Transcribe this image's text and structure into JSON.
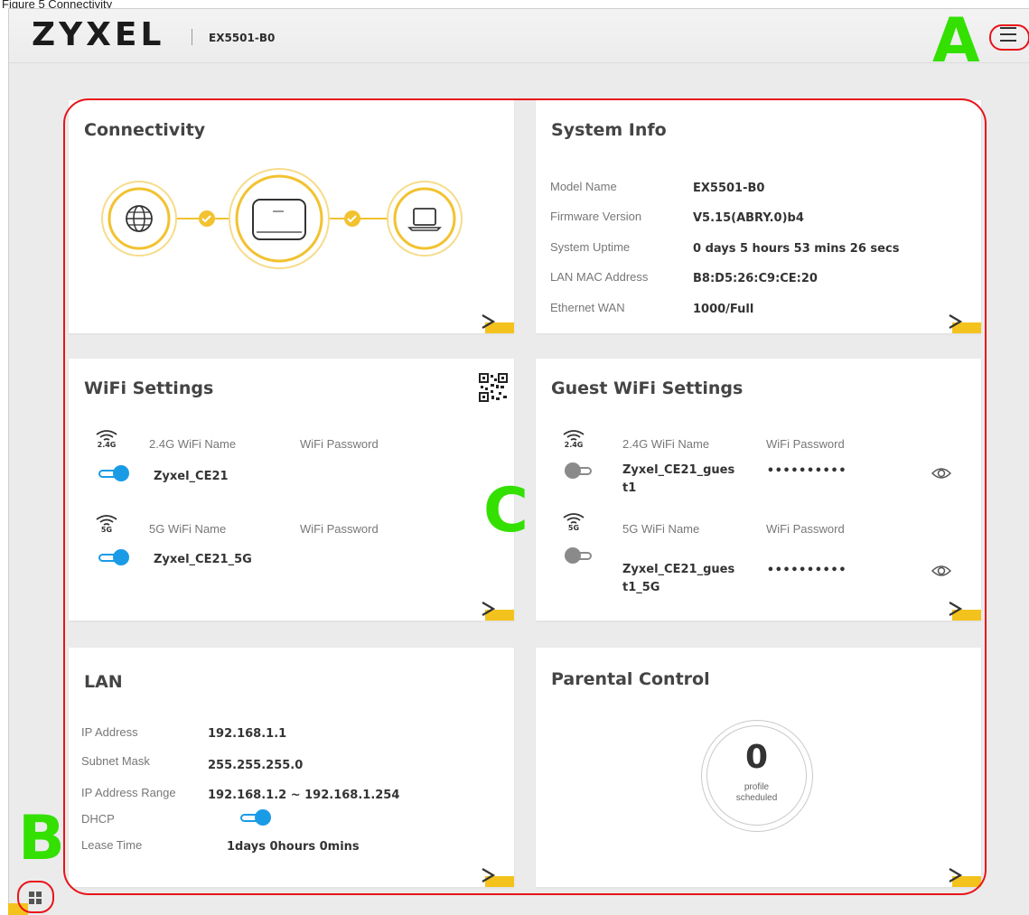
{
  "caption": "Figure 5 Connectivity",
  "header": {
    "logo": "ZYXEL",
    "model": "EX5501-B0"
  },
  "cards": {
    "connectivity": {
      "title": "Connectivity"
    },
    "system_info": {
      "title": "System Info",
      "rows": [
        {
          "label": "Model Name",
          "value": "EX5501-B0"
        },
        {
          "label": "Firmware Version",
          "value": "V5.15(ABRY.0)b4"
        },
        {
          "label": "System Uptime",
          "value": "0 days 5 hours 53 mins 26 secs"
        },
        {
          "label": "LAN MAC Address",
          "value": "B8:D5:26:C9:CE:20"
        },
        {
          "label": "Ethernet WAN",
          "value": "1000/Full"
        }
      ]
    },
    "wifi": {
      "title": "WiFi Settings",
      "band24": {
        "band": "2.4G",
        "name_label": "2.4G WiFi Name",
        "pwd_label": "WiFi Password",
        "ssid": "Zyxel_CE21",
        "enabled": true
      },
      "band5": {
        "band": "5G",
        "name_label": "5G WiFi Name",
        "pwd_label": "WiFi Password",
        "ssid": "Zyxel_CE21_5G",
        "enabled": true
      }
    },
    "guest_wifi": {
      "title": "Guest WiFi Settings",
      "band24": {
        "band": "2.4G",
        "name_label": "2.4G WiFi Name",
        "pwd_label": "WiFi Password",
        "ssid_line1": "Zyxel_CE21_gues",
        "ssid_line2": "t1",
        "password": "••••••••••",
        "enabled": false
      },
      "band5": {
        "band": "5G",
        "name_label": "5G WiFi Name",
        "pwd_label": "WiFi Password",
        "ssid_line1": "Zyxel_CE21_gues",
        "ssid_line2": "t1_5G",
        "password": "••••••••••",
        "enabled": false
      }
    },
    "lan": {
      "title": "LAN",
      "rows": [
        {
          "label": "IP Address",
          "value": "192.168.1.1"
        },
        {
          "label": "Subnet Mask",
          "value": "255.255.255.0"
        },
        {
          "label": "IP Address Range",
          "value": "192.168.1.2 ~ 192.168.1.254"
        },
        {
          "label": "DHCP",
          "value": ""
        },
        {
          "label": "Lease Time",
          "value": "1days 0hours 0mins"
        }
      ],
      "dhcp_enabled": true
    },
    "parental": {
      "title": "Parental Control",
      "count": "0",
      "caption_line1": "profile",
      "caption_line2": "scheduled"
    }
  },
  "annotations": {
    "a": "A",
    "b": "B",
    "c": "C"
  },
  "colors": {
    "accent_yellow": "#f4c21c",
    "toggle_blue": "#1a9be6",
    "annotation_green": "#33e000",
    "outline_red": "#e8141a"
  },
  "icons": [
    "menu-icon",
    "globe-icon",
    "router-icon",
    "laptop-icon",
    "check-icon",
    "qr-code-icon",
    "wifi-icon",
    "eye-icon",
    "chevron-right-icon",
    "apps-grid-icon"
  ]
}
